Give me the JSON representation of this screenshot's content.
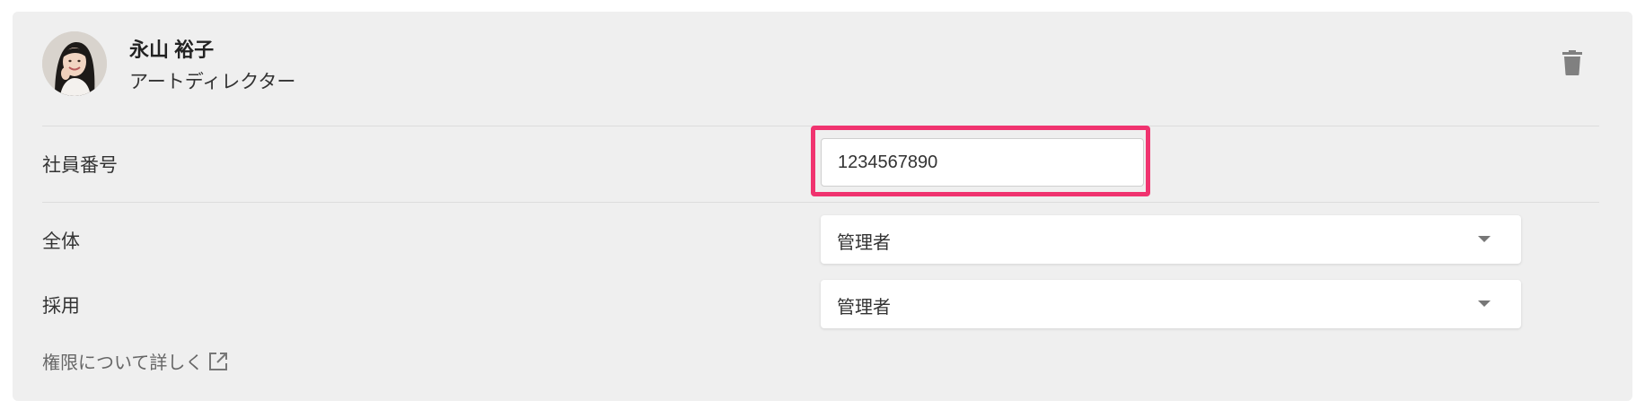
{
  "member": {
    "name": "永山 裕子",
    "role": "アートディレクター",
    "avatar_icon": "avatar-photo",
    "delete_icon": "trash-icon"
  },
  "fields": {
    "employee_number": {
      "label": "社員番号",
      "value": "1234567890"
    },
    "overall": {
      "label": "全体",
      "selected": "管理者"
    },
    "recruiting": {
      "label": "採用",
      "selected": "管理者"
    }
  },
  "permissions_link": {
    "label": "権限について詳しく",
    "icon": "external-link-icon"
  },
  "colors": {
    "card_background": "#efefef",
    "highlight": "#f0336f",
    "input_background": "#ffffff",
    "icon_gray": "#808080"
  }
}
